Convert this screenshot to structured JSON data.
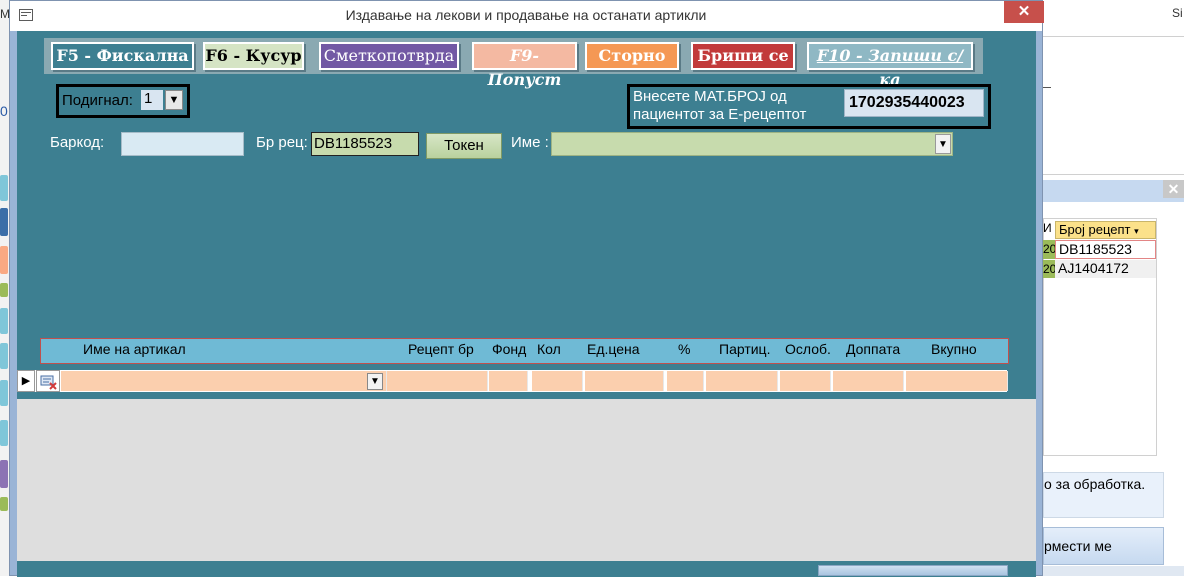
{
  "window": {
    "title": "Издавање на лекови и продавање на останати артикли",
    "close_glyph": "✕"
  },
  "function_keys": {
    "f5": "F5 - Фискална",
    "f6": "F6 - Кусур",
    "smetkopotvrda": "Сметкопотврда",
    "f9": "F9-Попуст",
    "storno": "Сторно",
    "brishi": "Бриши се",
    "f10": "F10 - Запиши с/ка"
  },
  "podignal": {
    "label": "Подигнал:",
    "value": "1"
  },
  "mat_broj": {
    "label": "Внесете МАТ.БРОЈ од пациентот за Е-рецептот",
    "value": "1702935440023"
  },
  "form": {
    "barkod_label": "Баркод:",
    "barkod_value": "",
    "br_rec_label": "Бр рец:",
    "br_rec_value": "DB1185523",
    "token_label": "Токен",
    "ime_label": "Име :",
    "ime_value": ""
  },
  "grid": {
    "columns": [
      "Име на артикал",
      "Рецепт бр",
      "Фонд",
      "Кол",
      "Ед.цена",
      "%",
      "Партиц.",
      "Ослоб.",
      "Доппата",
      "Вкупно"
    ]
  },
  "background": {
    "top_right_text": "Si",
    "left_m": "M",
    "left_digit": "0",
    "list_header": "Број рецепт",
    "list_small_header": "И",
    "list_small_cells": [
      "20",
      "20"
    ],
    "list_rows": [
      "DB1185523",
      "AJ1404172"
    ],
    "message": "о за обработка.",
    "button_label": "рмести ме",
    "close_glyph": "✕"
  },
  "colors": {
    "form_background": "#3d7f91",
    "column_header": "#6fbad5",
    "row_cells": "#fbcfae",
    "brishi": "#c23a3a",
    "storno": "#f59854",
    "smetkopotvrda": "#7259a4"
  }
}
